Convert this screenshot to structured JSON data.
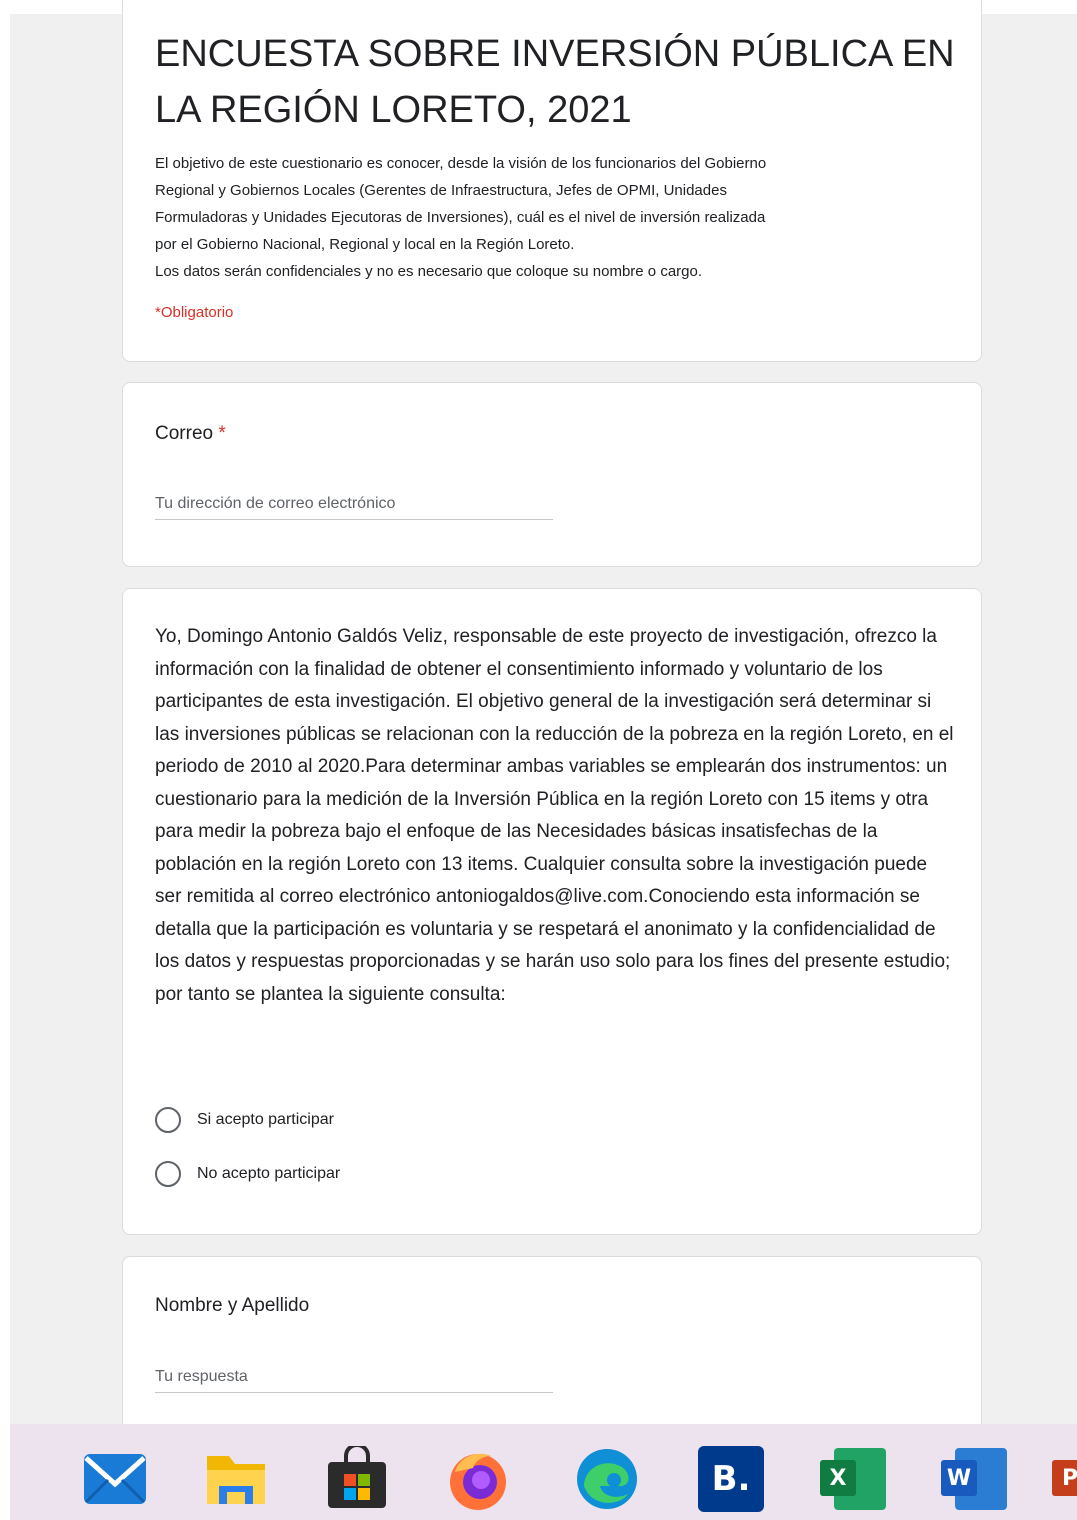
{
  "form": {
    "title": "ENCUESTA SOBRE INVERSIÓN PÚBLICA EN LA REGIÓN LORETO, 2021",
    "description_lines": [
      "El objetivo de este cuestionario es conocer, desde la visión de los funcionarios del Gobierno",
      "Regional y Gobiernos Locales (Gerentes de Infraestructura, Jefes de OPMI, Unidades",
      "Formuladoras y Unidades Ejecutoras de Inversiones), cuál es el nivel de inversión realizada",
      "por el Gobierno Nacional, Regional y local en la Región Loreto.",
      "Los datos serán confidenciales y no es necesario que coloque su nombre o cargo."
    ],
    "required_note": "*Obligatorio"
  },
  "email_question": {
    "label": "Correo",
    "required_mark": "*",
    "placeholder": "Tu dirección de correo electrónico"
  },
  "consent_question": {
    "text": "Yo, Domingo Antonio Galdós Veliz, responsable de este proyecto de investigación, ofrezco la información con la finalidad de obtener el consentimiento informado y voluntario de los participantes de esta investigación. El objetivo general de la investigación será determinar si las inversiones públicas se relacionan con la reducción de la pobreza en la región Loreto, en el periodo de 2010 al 2020.Para determinar ambas variables se emplearán dos instrumentos: un cuestionario para la medición de la Inversión Pública en la región Loreto con 15 items y otra para medir la pobreza bajo el enfoque de las Necesidades básicas insatisfechas de la población en la región Loreto con 13 items. Cualquier consulta sobre la investigación puede ser remitida al correo electrónico antoniogaldos@live.com.Conociendo esta información se detalla que la participación es voluntaria y se respetará el anonimato y la confidencialidad de los datos y respuestas proporcionadas y se harán uso solo para los fines del presente estudio; por tanto se plantea la siguiente consulta:",
    "options": [
      "Si acepto participar",
      "No acepto participar"
    ]
  },
  "name_question": {
    "label": "Nombre y Apellido",
    "placeholder": "Tu respuesta"
  },
  "taskbar": {
    "icons": [
      "mail-icon",
      "file-explorer-icon",
      "store-icon",
      "firefox-icon",
      "edge-icon",
      "booking-icon",
      "excel-icon",
      "word-icon",
      "powerpoint-icon"
    ],
    "booking_letter": "B.",
    "excel_letter": "X",
    "word_letter": "W",
    "powerpoint_letter": "P"
  }
}
